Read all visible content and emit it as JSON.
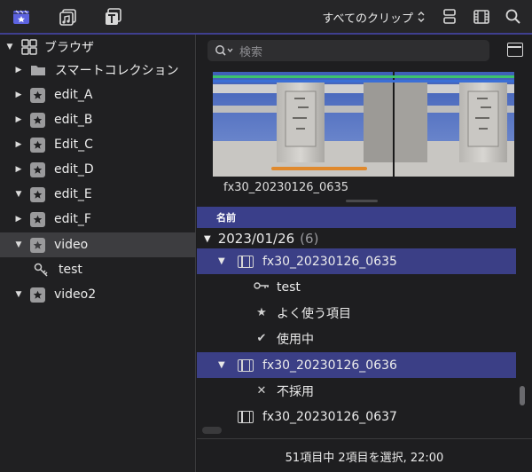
{
  "toolbar": {
    "clip_filter": "すべてのクリップ",
    "accent_color": "#3f3f8f"
  },
  "sidebar": {
    "items": [
      {
        "label": "ブラウザ",
        "icon": "library-grid-icon",
        "expanded": true
      },
      {
        "label": "スマートコレクション",
        "icon": "folder-icon",
        "expanded": false
      },
      {
        "label": "edit_A",
        "icon": "star-icon",
        "expanded": false
      },
      {
        "label": "edit_B",
        "icon": "star-icon",
        "expanded": false
      },
      {
        "label": "Edit_C",
        "icon": "star-icon",
        "expanded": false
      },
      {
        "label": "edit_D",
        "icon": "star-icon",
        "expanded": false
      },
      {
        "label": "edit_E",
        "icon": "star-icon",
        "expanded": true
      },
      {
        "label": "edit_F",
        "icon": "star-icon",
        "expanded": false
      },
      {
        "label": "video",
        "icon": "star-icon",
        "expanded": true,
        "selected": true
      },
      {
        "label": "test",
        "icon": "key-icon"
      },
      {
        "label": "video2",
        "icon": "star-icon",
        "expanded": true
      }
    ]
  },
  "browser": {
    "search_placeholder": "検索",
    "preview_clip_name": "fx30_20230126_0635",
    "column_header": "名前",
    "date_group": "2023/01/26",
    "date_count": "(6)",
    "rows": [
      {
        "label": "fx30_20230126_0635",
        "type": "clip"
      },
      {
        "label": "test",
        "type": "keyword"
      },
      {
        "label": "よく使う項目",
        "type": "favorite"
      },
      {
        "label": "使用中",
        "type": "used"
      },
      {
        "label": "fx30_20230126_0636",
        "type": "clip"
      },
      {
        "label": "不採用",
        "type": "rejected"
      },
      {
        "label": "fx30_20230126_0637",
        "type": "clip"
      }
    ],
    "status": "51項目中 2項目を選択, 22:00",
    "selection_color": "#3b3f86"
  }
}
